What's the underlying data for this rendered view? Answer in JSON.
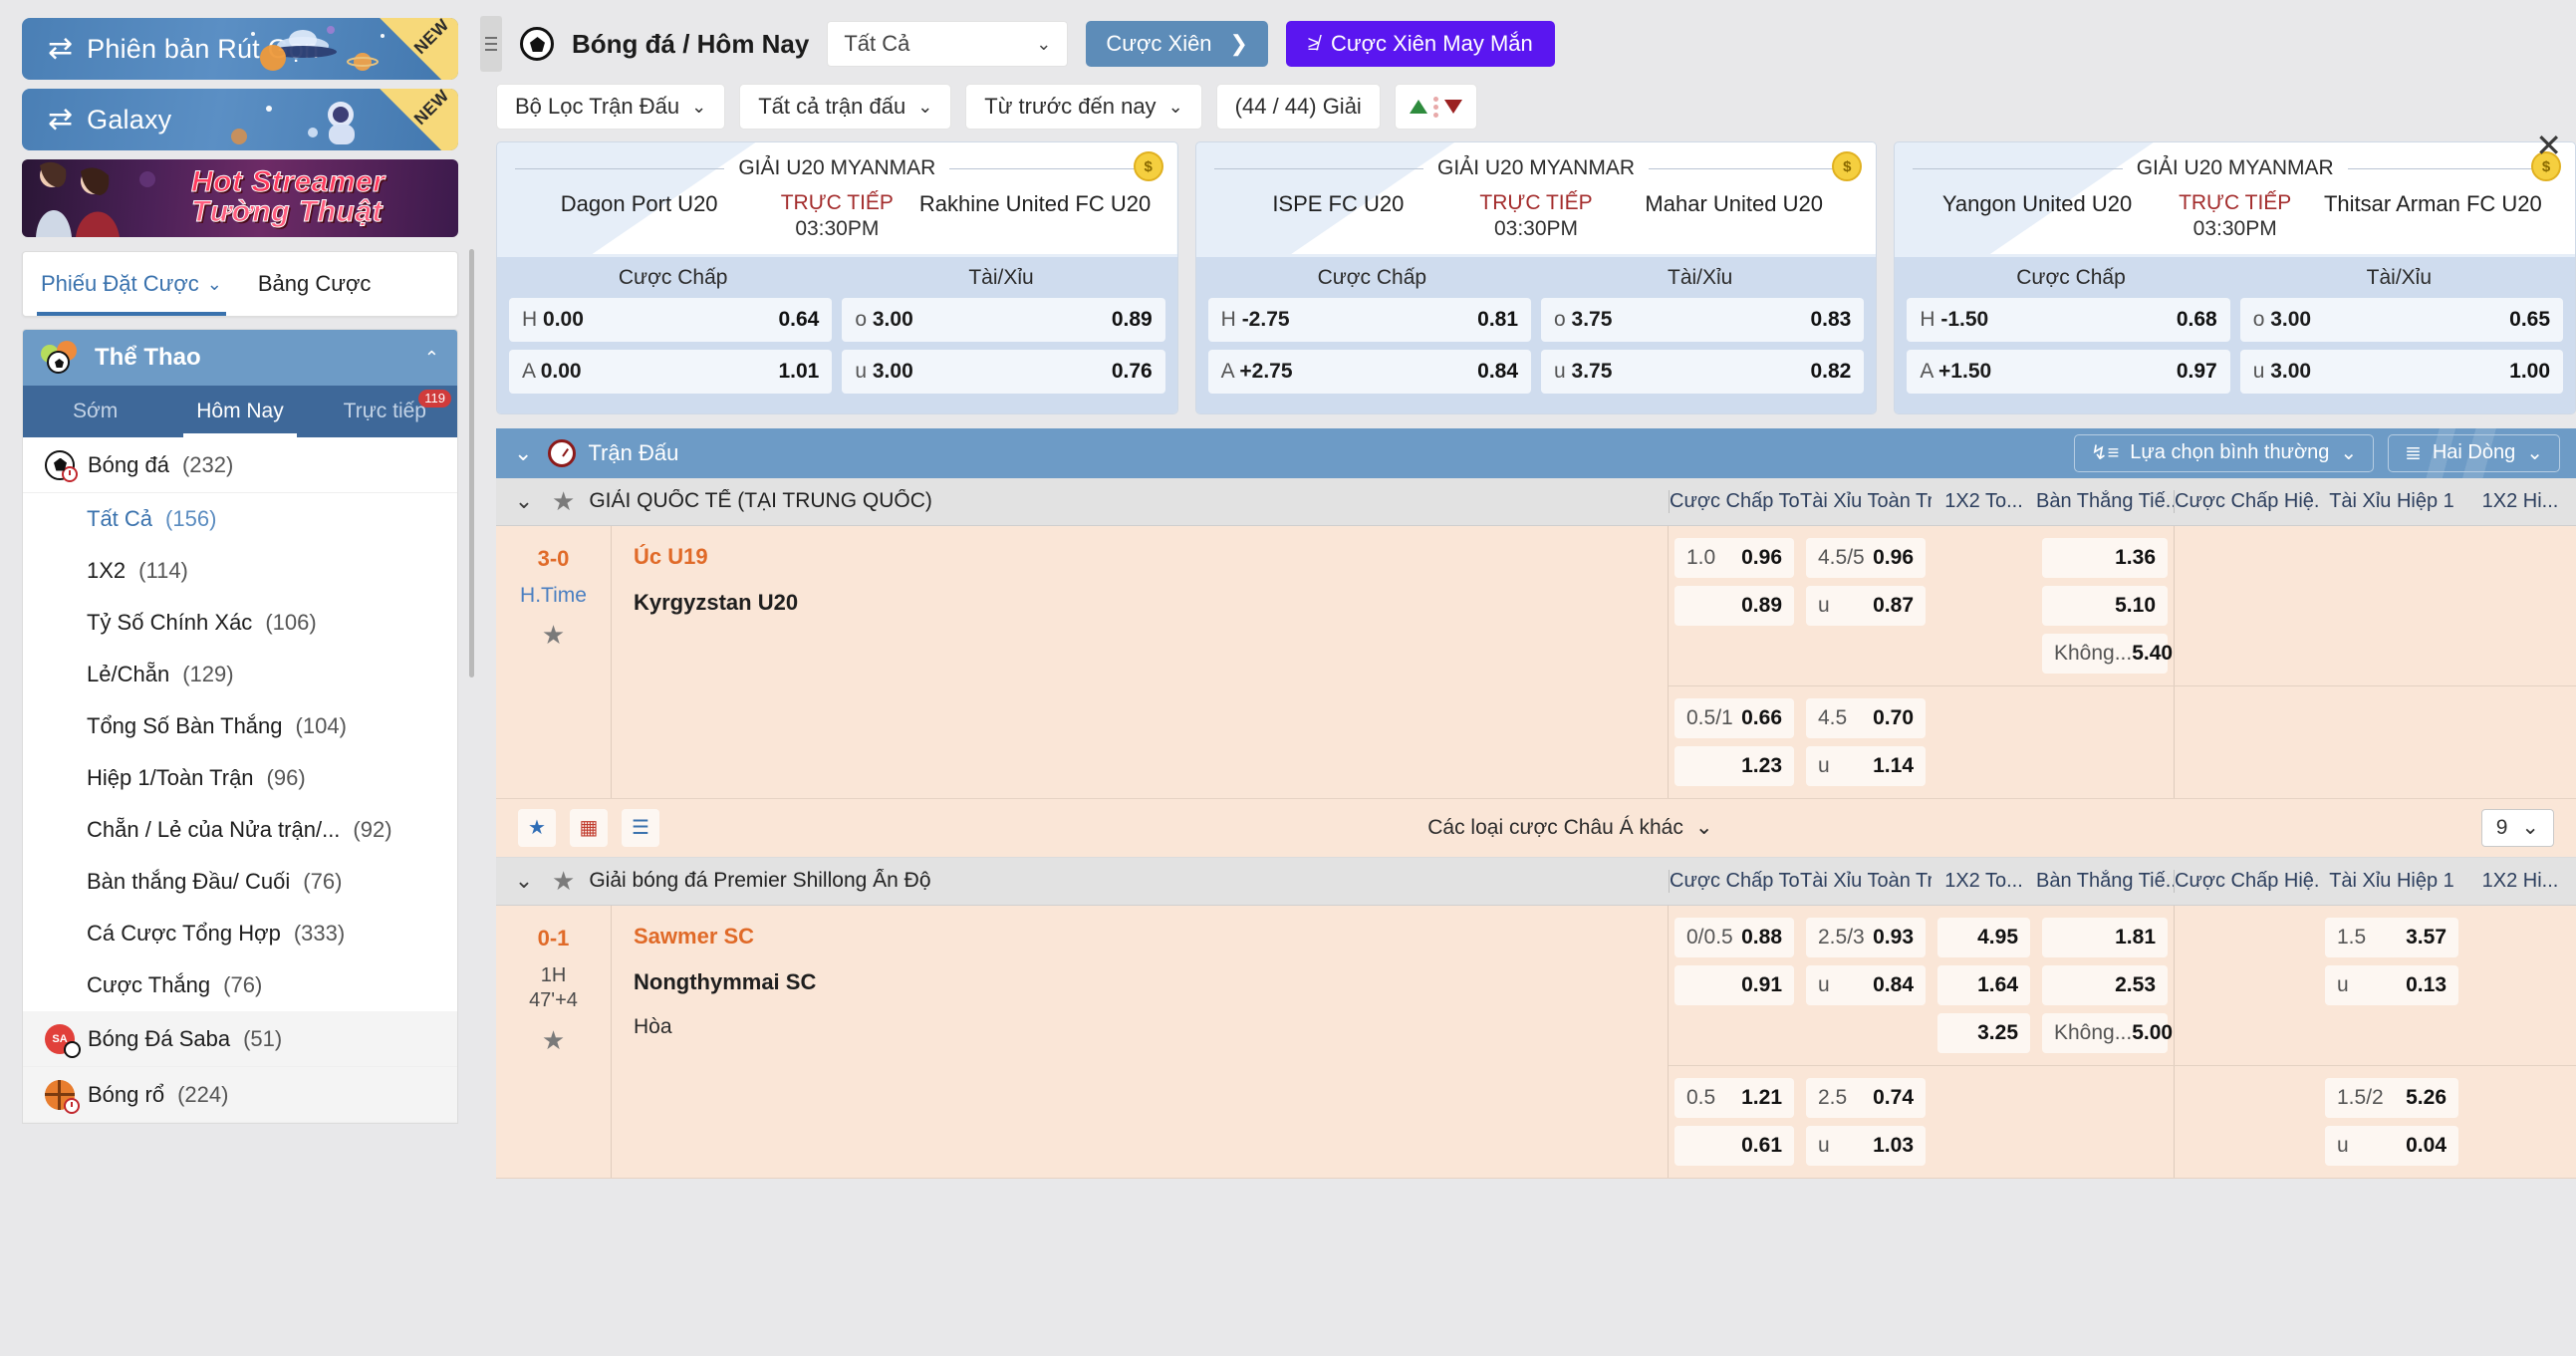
{
  "sidebar": {
    "promos": [
      {
        "label": "Phiên bản Rút Gọn",
        "badge": "NEW",
        "icon": "swap-icon"
      },
      {
        "label": "Galaxy",
        "badge": "NEW",
        "icon": "swap-icon"
      }
    ],
    "banner": {
      "line1": "Hot Streamer",
      "line2": "Tường Thuật"
    },
    "betslip_tabs": [
      {
        "label": "Phiếu Đặt Cược",
        "active": true,
        "chevron": "⌄"
      },
      {
        "label": "Bảng Cược",
        "active": false
      }
    ],
    "sport_header": {
      "title": "Thể Thao",
      "collapse": "⌃"
    },
    "sport_tabs": [
      {
        "label": "Sớm",
        "active": false,
        "badge": ""
      },
      {
        "label": "Hôm Nay",
        "active": true,
        "badge": ""
      },
      {
        "label": "Trực tiếp",
        "active": false,
        "badge": "119"
      }
    ],
    "groups": [
      {
        "icon": "soccer-live-icon",
        "label": "Bóng đá",
        "count": "(232)",
        "type": "sport"
      },
      {
        "label": "Tất Cả",
        "count": "(156)",
        "type": "sub",
        "active": true
      },
      {
        "label": "1X2",
        "count": "(114)",
        "type": "sub"
      },
      {
        "label": "Tỷ Số Chính Xác",
        "count": "(106)",
        "type": "sub"
      },
      {
        "label": "Lẻ/Chẵn",
        "count": "(129)",
        "type": "sub"
      },
      {
        "label": "Tổng Số Bàn Thắng",
        "count": "(104)",
        "type": "sub"
      },
      {
        "label": "Hiệp 1/Toàn Trận",
        "count": "(96)",
        "type": "sub"
      },
      {
        "label": "Chẵn / Lẻ của Nửa trận/...",
        "count": "(92)",
        "type": "sub"
      },
      {
        "label": "Bàn thắng Đầu/ Cuối",
        "count": "(76)",
        "type": "sub"
      },
      {
        "label": "Cá Cược Tổng Hợp",
        "count": "(333)",
        "type": "sub"
      },
      {
        "label": "Cược Thắng",
        "count": "(76)",
        "type": "sub"
      },
      {
        "icon": "saba-soccer-icon",
        "label": "Bóng Đá Saba",
        "count": "(51)",
        "type": "sport"
      },
      {
        "icon": "basketball-live-icon",
        "label": "Bóng rổ",
        "count": "(224)",
        "type": "sport"
      }
    ]
  },
  "topbar": {
    "title": "Bóng đá / Hôm Nay",
    "select_value": "Tất Cả",
    "parlay_button": "Cược Xiên",
    "parlay_arrow": "❯",
    "lucky_button": "Cược Xiên May Mắn"
  },
  "filters": [
    {
      "label": "Bộ Lọc Trận Đấu",
      "chevron": true
    },
    {
      "label": "Tất cả trận đấu",
      "chevron": true
    },
    {
      "label": "Từ trước đến nay",
      "chevron": true
    },
    {
      "label": "(44 / 44) Giải",
      "chevron": false
    }
  ],
  "live_cards": [
    {
      "league": "GIẢI U20 MYANMAR",
      "home": "Dagon Port U20",
      "away": "Rakhine United FC U20",
      "live_label": "TRỰC TIẾP",
      "time": "03:30PM",
      "col_headers": [
        "Cược Chấp",
        "Tài/Xỉu"
      ],
      "rows": [
        {
          "hk": "H",
          "hline": "0.00",
          "hodd": "0.64",
          "ok": "o",
          "oline": "3.00",
          "oodd": "0.89"
        },
        {
          "hk": "A",
          "hline": "0.00",
          "hodd": "1.01",
          "ok": "u",
          "oline": "3.00",
          "oodd": "0.76"
        }
      ]
    },
    {
      "league": "GIẢI U20 MYANMAR",
      "home": "ISPE FC U20",
      "away": "Mahar United U20",
      "live_label": "TRỰC TIẾP",
      "time": "03:30PM",
      "col_headers": [
        "Cược Chấp",
        "Tài/Xỉu"
      ],
      "rows": [
        {
          "hk": "H",
          "hline": "-2.75",
          "hodd": "0.81",
          "ok": "o",
          "oline": "3.75",
          "oodd": "0.83"
        },
        {
          "hk": "A",
          "hline": "+2.75",
          "hodd": "0.84",
          "ok": "u",
          "oline": "3.75",
          "oodd": "0.82"
        }
      ]
    },
    {
      "league": "GIẢI U20 MYANMAR",
      "home": "Yangon United U20",
      "away": "Thitsar Arman FC U20",
      "live_label": "TRỰC TIẾP",
      "time": "03:30PM",
      "col_headers": [
        "Cược Chấp",
        "Tài/Xỉu"
      ],
      "rows": [
        {
          "hk": "H",
          "hline": "-1.50",
          "hodd": "0.68",
          "ok": "o",
          "oline": "3.00",
          "oodd": "0.65"
        },
        {
          "hk": "A",
          "hline": "+1.50",
          "hodd": "0.97",
          "ok": "u",
          "oline": "3.00",
          "oodd": "1.00"
        }
      ]
    }
  ],
  "blue_toolbar": {
    "title": "Trận Đấu",
    "chevron": "⌄",
    "sort_button": "Lựa chọn bình thường",
    "rows_button": "Hai Dòng"
  },
  "columns": [
    "Cược Chấp To...",
    "Tài Xỉu Toàn Tr...",
    "1X2 To...",
    "Bàn Thắng Tiế...",
    "Cược Chấp Hiệ...",
    "Tài Xỉu Hiệp 1",
    "1X2 Hi..."
  ],
  "leagues": [
    {
      "name": "GIẢI QUỐC TẾ (TẠI TRUNG QUỐC)",
      "match": {
        "score": "3-0",
        "period": "H.Time",
        "period_extra": "",
        "team_home": "Úc U19",
        "team_away": "Kyrgyzstan U20",
        "draw_label": "",
        "main": {
          "handicap": [
            {
              "k": "1.0",
              "v": "0.96"
            },
            {
              "k": "",
              "v": "0.89"
            }
          ],
          "overunder": [
            {
              "k": "4.5/5",
              "v": "0.96"
            },
            {
              "k": "u",
              "v": "0.87"
            }
          ],
          "x12": [],
          "goals": [
            {
              "k": "",
              "v": "1.36"
            },
            {
              "k": "",
              "v": "5.10"
            },
            {
              "k": "Không...",
              "v": "5.40"
            }
          ],
          "h1_handicap": [],
          "h1_overunder": [],
          "h1_x12": []
        },
        "second": {
          "handicap": [
            {
              "k": "0.5/1",
              "v": "0.66"
            },
            {
              "k": "",
              "v": "1.23"
            }
          ],
          "overunder": [
            {
              "k": "4.5",
              "v": "0.70"
            },
            {
              "k": "u",
              "v": "1.14"
            }
          ],
          "h1_overunder": []
        }
      },
      "footer": {
        "more_label": "Các loại cược Châu Á khác",
        "count": "9"
      }
    },
    {
      "name": "Giải bóng đá Premier Shillong Ấn Độ",
      "match": {
        "score": "0-1",
        "period": "1H",
        "period_extra": "47'+4",
        "team_home": "Sawmer SC",
        "team_away": "Nongthymmai SC",
        "draw_label": "Hòa",
        "main": {
          "handicap": [
            {
              "k": "0/0.5",
              "v": "0.88"
            },
            {
              "k": "",
              "v": "0.91"
            }
          ],
          "overunder": [
            {
              "k": "2.5/3",
              "v": "0.93"
            },
            {
              "k": "u",
              "v": "0.84"
            }
          ],
          "x12": [
            {
              "k": "",
              "v": "4.95"
            },
            {
              "k": "",
              "v": "1.64"
            },
            {
              "k": "",
              "v": "3.25"
            }
          ],
          "goals": [
            {
              "k": "",
              "v": "1.81"
            },
            {
              "k": "",
              "v": "2.53"
            },
            {
              "k": "Không...",
              "v": "5.00"
            }
          ],
          "h1_handicap": [],
          "h1_overunder": [
            {
              "k": "1.5",
              "v": "3.57"
            },
            {
              "k": "u",
              "v": "0.13"
            }
          ],
          "h1_x12": []
        },
        "second": {
          "handicap": [
            {
              "k": "0.5",
              "v": "1.21"
            },
            {
              "k": "",
              "v": "0.61"
            }
          ],
          "overunder": [
            {
              "k": "2.5",
              "v": "0.74"
            },
            {
              "k": "u",
              "v": "1.03"
            }
          ],
          "h1_overunder": [
            {
              "k": "1.5/2",
              "v": "5.26"
            },
            {
              "k": "u",
              "v": "0.04"
            }
          ]
        }
      }
    }
  ],
  "colors": {
    "accent_blue": "#3a72ad",
    "header_blue": "#6d9bc6",
    "tabs_blue": "#3e6899",
    "lucky_purple": "#5a16f0",
    "live_red": "#a32c2c",
    "row_peach": "#fae6d7",
    "score_orange": "#e06a28"
  }
}
